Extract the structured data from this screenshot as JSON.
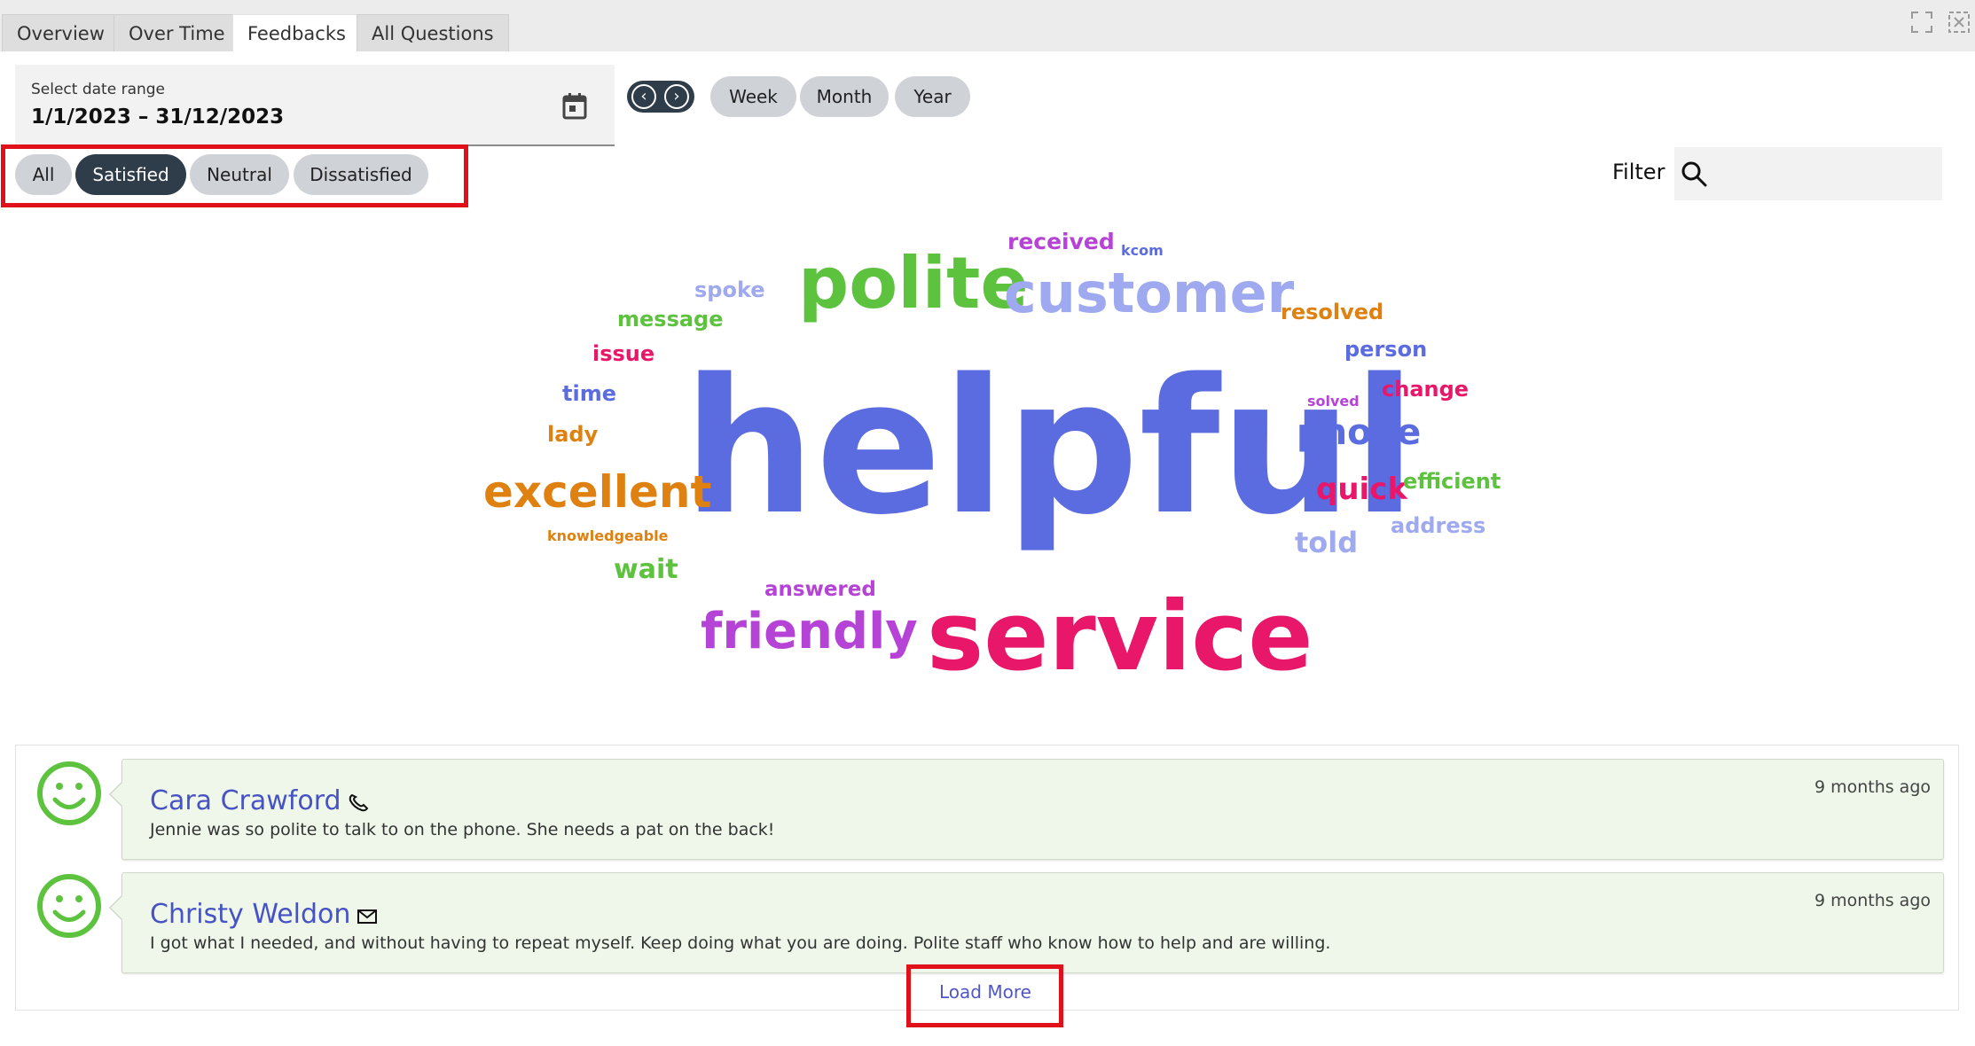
{
  "tabs": [
    {
      "label": "Overview",
      "active": false
    },
    {
      "label": "Over Time",
      "active": false
    },
    {
      "label": "Feedbacks",
      "active": true
    },
    {
      "label": "All Questions",
      "active": false
    }
  ],
  "window_icons": [
    "expand-icon",
    "close-icon"
  ],
  "date_range": {
    "label": "Select date range",
    "value": "1/1/2023 – 31/12/2023",
    "icon": "calendar-icon"
  },
  "period_nav": {
    "prev_icon": "chevron-left-icon",
    "next_icon": "chevron-right-icon"
  },
  "period_buttons": [
    "Week",
    "Month",
    "Year"
  ],
  "sentiment_filters": [
    {
      "label": "All",
      "selected": false
    },
    {
      "label": "Satisfied",
      "selected": true
    },
    {
      "label": "Neutral",
      "selected": false
    },
    {
      "label": "Dissatisfied",
      "selected": false
    }
  ],
  "filter": {
    "label": "Filter",
    "value": "",
    "icon": "search-icon"
  },
  "word_cloud": [
    {
      "text": "helpful",
      "color": "#5b6be0"
    },
    {
      "text": "service",
      "color": "#e8176a"
    },
    {
      "text": "polite",
      "color": "#5dc23e"
    },
    {
      "text": "customer",
      "color": "#9ea9f0"
    },
    {
      "text": "excellent",
      "color": "#de8110"
    },
    {
      "text": "friendly",
      "color": "#b543d6"
    },
    {
      "text": "phone",
      "color": "#5b6be0"
    },
    {
      "text": "quick",
      "color": "#e8176a"
    },
    {
      "text": "told",
      "color": "#9ea9f0"
    },
    {
      "text": "wait",
      "color": "#5dc23e"
    },
    {
      "text": "received",
      "color": "#b543d6"
    },
    {
      "text": "resolved",
      "color": "#de8110"
    },
    {
      "text": "person",
      "color": "#5b6be0"
    },
    {
      "text": "change",
      "color": "#e8176a"
    },
    {
      "text": "efficient",
      "color": "#5dc23e"
    },
    {
      "text": "address",
      "color": "#9ea9f0"
    },
    {
      "text": "spoke",
      "color": "#9ea9f0"
    },
    {
      "text": "message",
      "color": "#5dc23e"
    },
    {
      "text": "issue",
      "color": "#e8176a"
    },
    {
      "text": "time",
      "color": "#5b6be0"
    },
    {
      "text": "lady",
      "color": "#de8110"
    },
    {
      "text": "answered",
      "color": "#b543d6"
    },
    {
      "text": "knowledgeable",
      "color": "#de8110"
    },
    {
      "text": "kcom",
      "color": "#5b6be0"
    },
    {
      "text": "solved",
      "color": "#b543d6"
    }
  ],
  "feedbacks": [
    {
      "name": "Cara Crawford",
      "contact_icon": "phone-icon",
      "time": "9 months ago",
      "text": "Jennie was so polite to talk to on the phone. She needs a pat on the back!",
      "sentiment_icon": "smiley-icon",
      "sentiment_color": "#5dc23e"
    },
    {
      "name": "Christy Weldon",
      "contact_icon": "envelope-icon",
      "time": "9 months ago",
      "text": "I got what I needed, and without having to repeat myself. Keep doing what you are doing. Polite staff who know how to help and are willing.",
      "sentiment_icon": "smiley-icon",
      "sentiment_color": "#5dc23e"
    }
  ],
  "load_more": "Load More",
  "colors": {
    "accent_dark": "#2f3c4a",
    "highlight": "#e0111b",
    "card_bg": "#eef7e9",
    "link": "#4752c4"
  }
}
